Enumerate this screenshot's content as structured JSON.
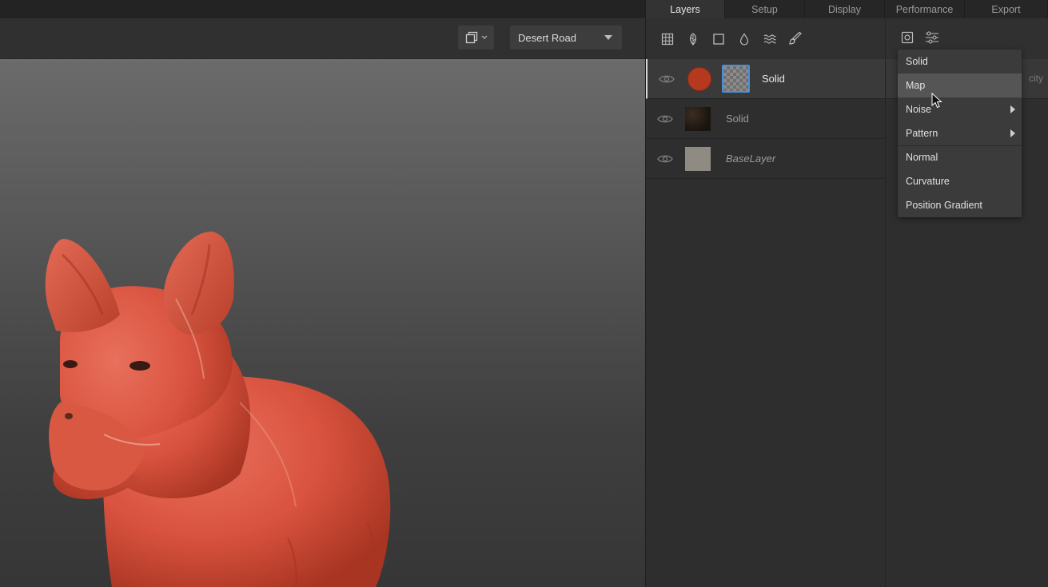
{
  "viewport": {
    "view_icon": "window-layout-icon",
    "environment_select": "Desert Road"
  },
  "tabs": [
    {
      "label": "Layers",
      "active": true
    },
    {
      "label": "Setup",
      "active": false
    },
    {
      "label": "Display",
      "active": false
    },
    {
      "label": "Performance",
      "active": false
    },
    {
      "label": "Export",
      "active": false
    }
  ],
  "layer_tools": [
    "grid-icon",
    "leaf-icon",
    "square-icon",
    "drop-icon",
    "waves-icon",
    "brush-icon"
  ],
  "layers": [
    {
      "name": "Solid",
      "selected": true,
      "color": "#b5391f",
      "has_mask": true
    },
    {
      "name": "Solid",
      "selected": false,
      "thumb": "dark-texture"
    },
    {
      "name": "BaseLayer",
      "selected": false,
      "thumb": "#8f8a82",
      "italic": true
    }
  ],
  "props": {
    "tools": [
      "target-icon",
      "sliders-icon"
    ],
    "row_label_partial": "city"
  },
  "menu": {
    "items": [
      {
        "label": "Solid",
        "submenu": false
      },
      {
        "label": "Map",
        "submenu": false,
        "hover": true
      },
      {
        "label": "Noise",
        "submenu": true
      },
      {
        "label": "Pattern",
        "submenu": true
      },
      {
        "label": "Normal",
        "submenu": false
      },
      {
        "label": "Curvature",
        "submenu": false
      },
      {
        "label": "Position Gradient",
        "submenu": false
      }
    ]
  },
  "colors": {
    "accent_blue": "#4a90d9",
    "model_red": "#d9533f",
    "panel_bg": "#2e2e2e"
  }
}
